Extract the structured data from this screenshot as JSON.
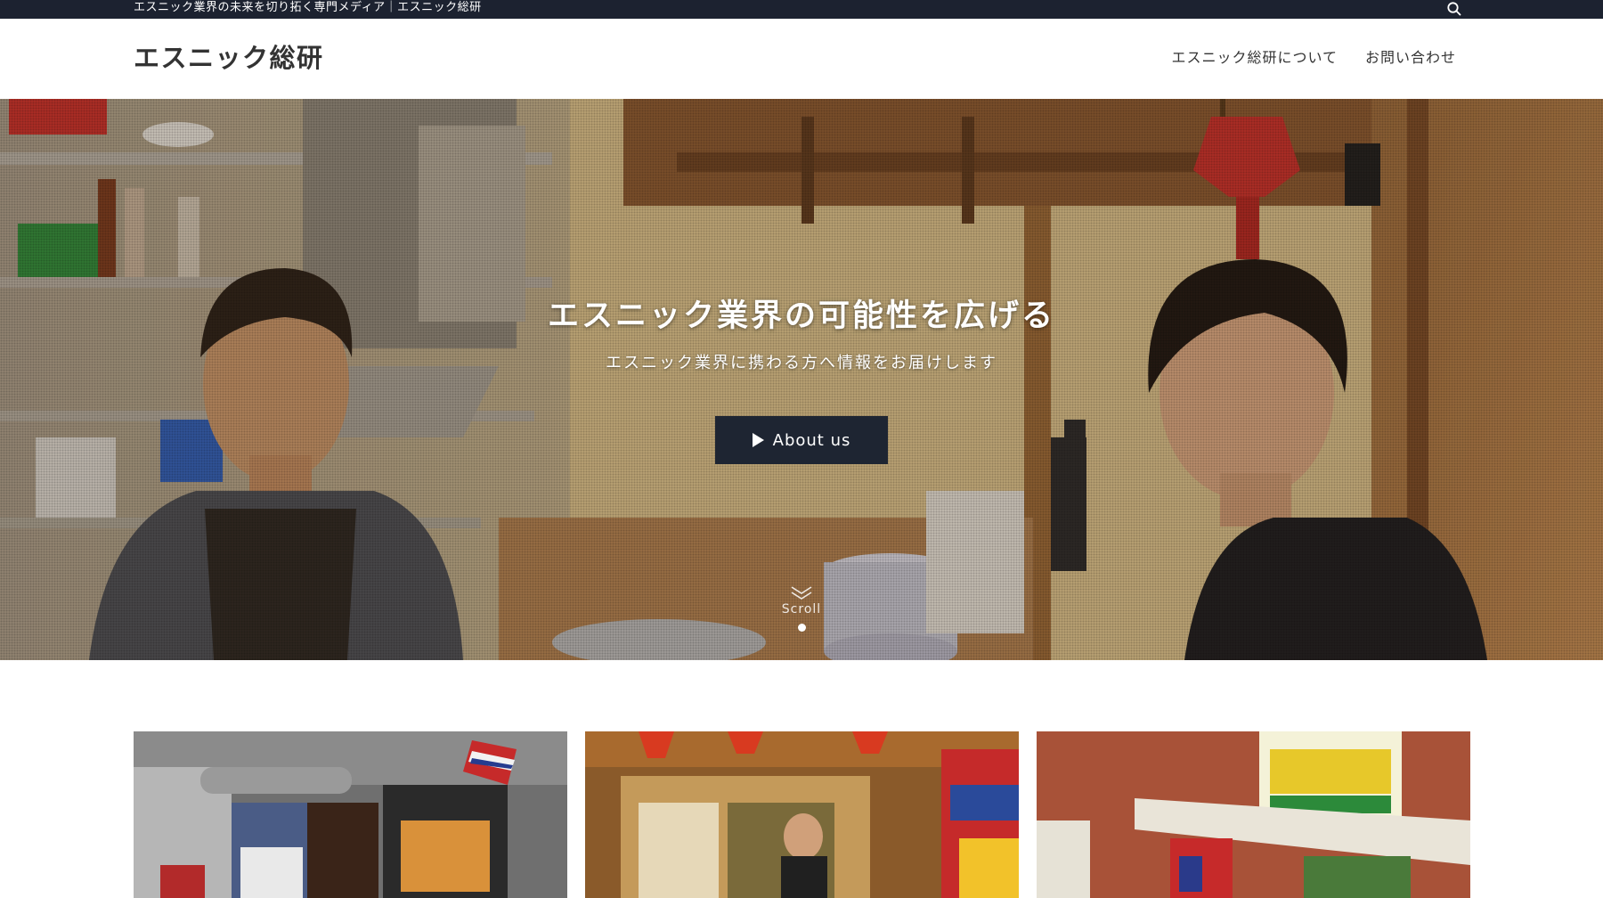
{
  "topbar": {
    "tagline": "エスニック業界の未来を切り拓く専門メディア｜エスニック総研",
    "search_icon": "search-icon"
  },
  "header": {
    "site_title": "エスニック総研",
    "nav": [
      {
        "label": "エスニック総研について"
      },
      {
        "label": "お問い合わせ"
      }
    ]
  },
  "hero": {
    "title": "エスニック業界の可能性を広げる",
    "subtitle": "エスニック業界に携わる方へ情報をお届けします",
    "button_label": "About us",
    "button_icon": "play-icon",
    "scroll_label": "Scroll",
    "scroll_icon": "chevron-down-icon"
  },
  "cards": [
    {
      "name": "article-card-1"
    },
    {
      "name": "article-card-2"
    },
    {
      "name": "article-card-3"
    }
  ],
  "colors": {
    "topbar_bg": "#1c2230",
    "button_bg": "#1e2532",
    "text": "#333333"
  }
}
